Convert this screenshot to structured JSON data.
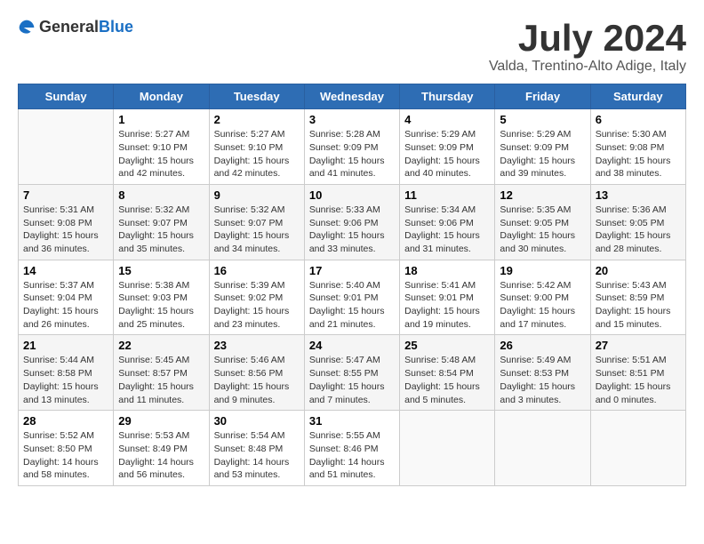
{
  "logo": {
    "general": "General",
    "blue": "Blue"
  },
  "title": "July 2024",
  "location": "Valda, Trentino-Alto Adige, Italy",
  "headers": [
    "Sunday",
    "Monday",
    "Tuesday",
    "Wednesday",
    "Thursday",
    "Friday",
    "Saturday"
  ],
  "weeks": [
    [
      {
        "day": "",
        "text": ""
      },
      {
        "day": "1",
        "text": "Sunrise: 5:27 AM\nSunset: 9:10 PM\nDaylight: 15 hours\nand 42 minutes."
      },
      {
        "day": "2",
        "text": "Sunrise: 5:27 AM\nSunset: 9:10 PM\nDaylight: 15 hours\nand 42 minutes."
      },
      {
        "day": "3",
        "text": "Sunrise: 5:28 AM\nSunset: 9:09 PM\nDaylight: 15 hours\nand 41 minutes."
      },
      {
        "day": "4",
        "text": "Sunrise: 5:29 AM\nSunset: 9:09 PM\nDaylight: 15 hours\nand 40 minutes."
      },
      {
        "day": "5",
        "text": "Sunrise: 5:29 AM\nSunset: 9:09 PM\nDaylight: 15 hours\nand 39 minutes."
      },
      {
        "day": "6",
        "text": "Sunrise: 5:30 AM\nSunset: 9:08 PM\nDaylight: 15 hours\nand 38 minutes."
      }
    ],
    [
      {
        "day": "7",
        "text": "Sunrise: 5:31 AM\nSunset: 9:08 PM\nDaylight: 15 hours\nand 36 minutes."
      },
      {
        "day": "8",
        "text": "Sunrise: 5:32 AM\nSunset: 9:07 PM\nDaylight: 15 hours\nand 35 minutes."
      },
      {
        "day": "9",
        "text": "Sunrise: 5:32 AM\nSunset: 9:07 PM\nDaylight: 15 hours\nand 34 minutes."
      },
      {
        "day": "10",
        "text": "Sunrise: 5:33 AM\nSunset: 9:06 PM\nDaylight: 15 hours\nand 33 minutes."
      },
      {
        "day": "11",
        "text": "Sunrise: 5:34 AM\nSunset: 9:06 PM\nDaylight: 15 hours\nand 31 minutes."
      },
      {
        "day": "12",
        "text": "Sunrise: 5:35 AM\nSunset: 9:05 PM\nDaylight: 15 hours\nand 30 minutes."
      },
      {
        "day": "13",
        "text": "Sunrise: 5:36 AM\nSunset: 9:05 PM\nDaylight: 15 hours\nand 28 minutes."
      }
    ],
    [
      {
        "day": "14",
        "text": "Sunrise: 5:37 AM\nSunset: 9:04 PM\nDaylight: 15 hours\nand 26 minutes."
      },
      {
        "day": "15",
        "text": "Sunrise: 5:38 AM\nSunset: 9:03 PM\nDaylight: 15 hours\nand 25 minutes."
      },
      {
        "day": "16",
        "text": "Sunrise: 5:39 AM\nSunset: 9:02 PM\nDaylight: 15 hours\nand 23 minutes."
      },
      {
        "day": "17",
        "text": "Sunrise: 5:40 AM\nSunset: 9:01 PM\nDaylight: 15 hours\nand 21 minutes."
      },
      {
        "day": "18",
        "text": "Sunrise: 5:41 AM\nSunset: 9:01 PM\nDaylight: 15 hours\nand 19 minutes."
      },
      {
        "day": "19",
        "text": "Sunrise: 5:42 AM\nSunset: 9:00 PM\nDaylight: 15 hours\nand 17 minutes."
      },
      {
        "day": "20",
        "text": "Sunrise: 5:43 AM\nSunset: 8:59 PM\nDaylight: 15 hours\nand 15 minutes."
      }
    ],
    [
      {
        "day": "21",
        "text": "Sunrise: 5:44 AM\nSunset: 8:58 PM\nDaylight: 15 hours\nand 13 minutes."
      },
      {
        "day": "22",
        "text": "Sunrise: 5:45 AM\nSunset: 8:57 PM\nDaylight: 15 hours\nand 11 minutes."
      },
      {
        "day": "23",
        "text": "Sunrise: 5:46 AM\nSunset: 8:56 PM\nDaylight: 15 hours\nand 9 minutes."
      },
      {
        "day": "24",
        "text": "Sunrise: 5:47 AM\nSunset: 8:55 PM\nDaylight: 15 hours\nand 7 minutes."
      },
      {
        "day": "25",
        "text": "Sunrise: 5:48 AM\nSunset: 8:54 PM\nDaylight: 15 hours\nand 5 minutes."
      },
      {
        "day": "26",
        "text": "Sunrise: 5:49 AM\nSunset: 8:53 PM\nDaylight: 15 hours\nand 3 minutes."
      },
      {
        "day": "27",
        "text": "Sunrise: 5:51 AM\nSunset: 8:51 PM\nDaylight: 15 hours\nand 0 minutes."
      }
    ],
    [
      {
        "day": "28",
        "text": "Sunrise: 5:52 AM\nSunset: 8:50 PM\nDaylight: 14 hours\nand 58 minutes."
      },
      {
        "day": "29",
        "text": "Sunrise: 5:53 AM\nSunset: 8:49 PM\nDaylight: 14 hours\nand 56 minutes."
      },
      {
        "day": "30",
        "text": "Sunrise: 5:54 AM\nSunset: 8:48 PM\nDaylight: 14 hours\nand 53 minutes."
      },
      {
        "day": "31",
        "text": "Sunrise: 5:55 AM\nSunset: 8:46 PM\nDaylight: 14 hours\nand 51 minutes."
      },
      {
        "day": "",
        "text": ""
      },
      {
        "day": "",
        "text": ""
      },
      {
        "day": "",
        "text": ""
      }
    ]
  ]
}
